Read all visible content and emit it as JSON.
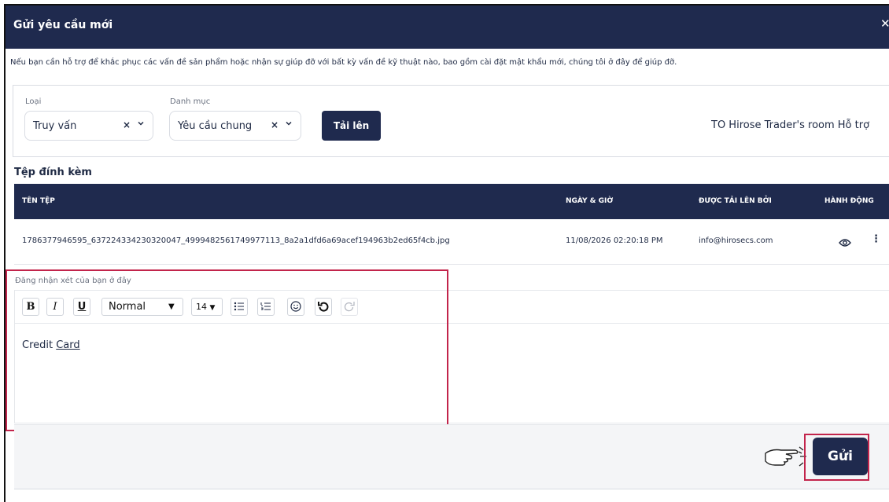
{
  "header": {
    "title": "Gửi yêu cầu mới",
    "close_icon": "close-icon"
  },
  "intro": "Nếu bạn cần hỗ trợ để khắc phục các vấn đề sản phẩm hoặc nhận sự giúp đỡ với bất kỳ vấn đề kỹ thuật nào, bao gồm cài đặt mật khẩu mới, chúng tôi ở đây để giúp đỡ.",
  "filters": {
    "type_label": "Loại",
    "type_value": "Truy vấn",
    "category_label": "Danh mục",
    "category_value": "Yêu cầu chung",
    "clear_glyph": "×",
    "chevron_glyph": "⌄",
    "upload_label": "Tải lên",
    "room_text": "TO Hirose Trader's room Hỗ trợ"
  },
  "attachments": {
    "heading": "Tệp đính kèm",
    "columns": [
      "TÊN TỆP",
      "NGÀY & GIỜ",
      "ĐƯỢC TẢI LÊN BỞI",
      "HÀNH ĐỘNG"
    ],
    "rows": [
      {
        "file": "1786377946595_637224334230320047_4999482561749977113_8a2a1dfd6a69acef194963b2ed65f4cb.jpg",
        "datetime": "11/08/2026 02:20:18 PM",
        "uploader": "info@hirosecs.com"
      }
    ]
  },
  "comment": {
    "label": "Đăng nhận xét của bạn ở đây",
    "toolbar": {
      "bold": "B",
      "italic": "I",
      "underline": "U",
      "format": "Normal",
      "size": "14",
      "dropdown_glyph": "▼"
    },
    "content_plain": "Credit ",
    "content_underlined": "Card"
  },
  "footer": {
    "send_label": "Gửi"
  },
  "colors": {
    "navy": "#1f2a4e",
    "highlight": "#c2244b"
  }
}
